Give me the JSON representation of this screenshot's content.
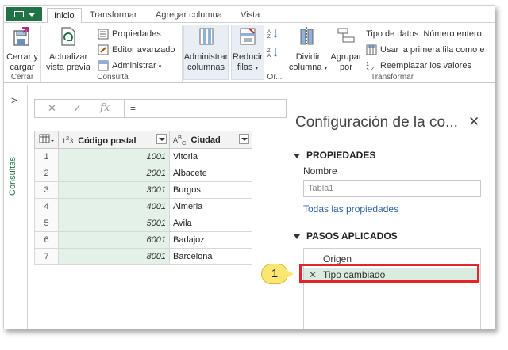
{
  "tabs": [
    "Inicio",
    "Transformar",
    "Agregar columna",
    "Vista"
  ],
  "ribbon": {
    "close_btn": [
      "Cerrar y",
      "cargar"
    ],
    "refresh_btn": [
      "Actualizar",
      "vista previa"
    ],
    "properties": "Propiedades",
    "advanced_editor": "Editor avanzado",
    "manage": "Administrar",
    "manage_columns": [
      "Administrar",
      "columnas"
    ],
    "reduce_rows": [
      "Reducir",
      "filas"
    ],
    "split_column": [
      "Dividir",
      "columna"
    ],
    "group_by": [
      "Agrupar",
      "por"
    ],
    "data_type": "Tipo de datos: Número entero",
    "first_row_header": "Usar la primera fila como e",
    "replace_values": "Reemplazar los valores",
    "groups": {
      "close": "Cerrar",
      "query": "Consulta",
      "or": "Or...",
      "transform": "Transformar"
    }
  },
  "leftnav": {
    "label": "Consultas"
  },
  "formula": {
    "value": "="
  },
  "table": {
    "headers": [
      {
        "icon": "1²3",
        "label": "Código postal"
      },
      {
        "icon": "A^B_C",
        "label": "Ciudad"
      }
    ],
    "rows": [
      {
        "n": "1",
        "cp": "1001",
        "city": "Vitoria"
      },
      {
        "n": "2",
        "cp": "2001",
        "city": "Albacete"
      },
      {
        "n": "3",
        "cp": "3001",
        "city": "Burgos"
      },
      {
        "n": "4",
        "cp": "4001",
        "city": "Almeria"
      },
      {
        "n": "5",
        "cp": "5001",
        "city": "Avila"
      },
      {
        "n": "6",
        "cp": "6001",
        "city": "Badajoz"
      },
      {
        "n": "7",
        "cp": "8001",
        "city": "Barcelona"
      }
    ]
  },
  "pane": {
    "title": "Configuración de la co...",
    "properties_header": "PROPIEDADES",
    "name_label": "Nombre",
    "name_value": "Tabla1",
    "all_properties": "Todas las propiedades",
    "steps_header": "PASOS APLICADOS",
    "steps": [
      "Origen",
      "Tipo cambiado"
    ]
  },
  "callout": "1",
  "colors": {
    "brand": "#217346",
    "highlight_box": "#e3242b",
    "callout": "#fbe673"
  }
}
